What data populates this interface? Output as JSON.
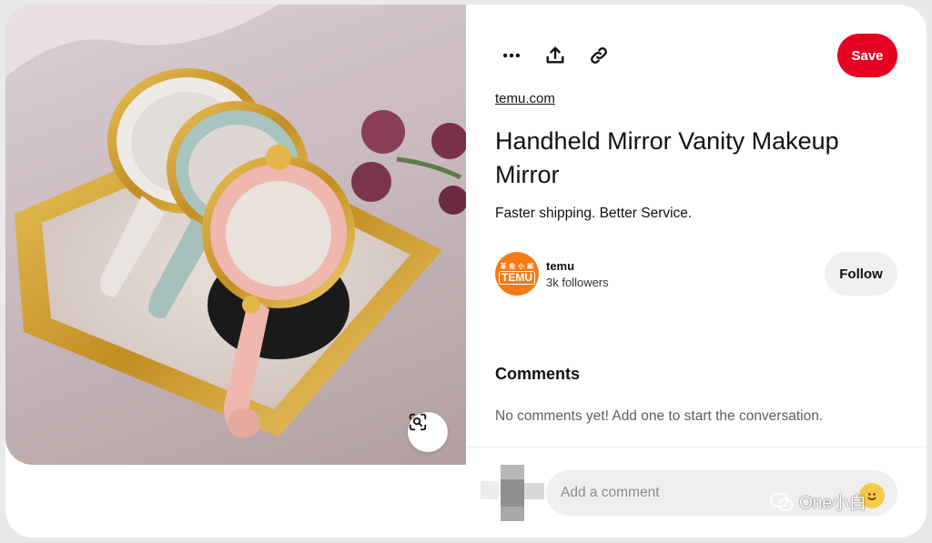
{
  "toolbar": {
    "more_icon": "more-horizontal-icon",
    "share_icon": "share-upload-icon",
    "link_icon": "copy-link-icon",
    "save_label": "Save"
  },
  "pin": {
    "source": "temu.com",
    "title": "Handheld Mirror Vanity Makeup Mirror",
    "description": "Faster shipping. Better Service."
  },
  "creator": {
    "avatar_small_text": "革 免 小 邮",
    "avatar_brand": "TEMU",
    "name": "temu",
    "followers": "3k followers",
    "follow_label": "Follow"
  },
  "comments": {
    "heading": "Comments",
    "empty_text": "No comments yet! Add one to start the conversation.",
    "input_placeholder": "Add a comment"
  },
  "watermark": {
    "text": "One小白"
  },
  "colors": {
    "save_red": "#e60023",
    "temu_orange": "#f57b17",
    "follow_gray": "#efefef"
  }
}
